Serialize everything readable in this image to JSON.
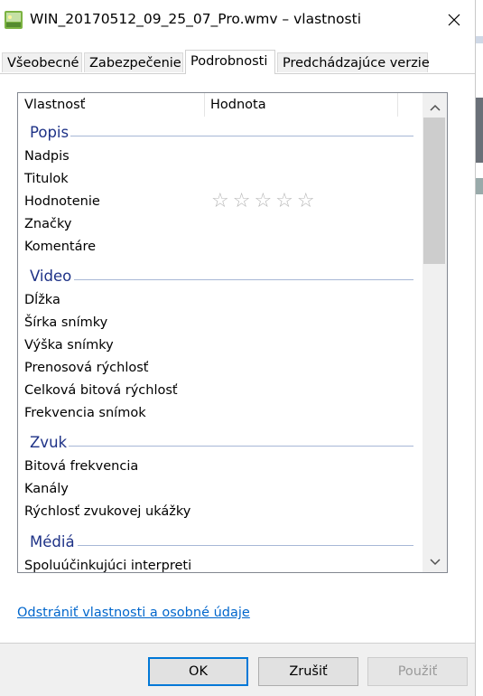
{
  "window": {
    "title": "WIN_20170512_09_25_07_Pro.wmv – vlastnosti",
    "close_icon": "close-icon"
  },
  "tabs": [
    {
      "label": "Všeobecné",
      "active": false
    },
    {
      "label": "Zabezpečenie",
      "active": false
    },
    {
      "label": "Podrobnosti",
      "active": true
    },
    {
      "label": "Predchádzajúce verzie",
      "active": false
    }
  ],
  "listview": {
    "columns": [
      "Vlastnosť",
      "Hodnota"
    ],
    "groups": {
      "popis": {
        "label": "Popis",
        "items": [
          "Nadpis",
          "Titulok",
          "Hodnotenie",
          "Značky",
          "Komentáre"
        ]
      },
      "video": {
        "label": "Video",
        "items": [
          "Dĺžka",
          "Šírka snímky",
          "Výška snímky",
          "Prenosová rýchlosť",
          "Celková bitová rýchlosť",
          "Frekvencia snímok"
        ]
      },
      "zvuk": {
        "label": "Zvuk",
        "items": [
          "Bitová frekvencia",
          "Kanály",
          "Rýchlosť zvukovej ukážky"
        ]
      },
      "media": {
        "label": "Médiá",
        "items": [
          "Spoluúčinkujúci interpreti"
        ]
      }
    },
    "rating": {
      "stars_filled": 0,
      "stars_total": 5,
      "glyphs": "☆☆☆☆☆"
    },
    "scroll_position": 0
  },
  "links": {
    "remove_properties": "Odstrániť vlastnosti a osobné údaje"
  },
  "buttons": {
    "ok": "OK",
    "cancel": "Zrušiť",
    "apply": "Použiť"
  },
  "colors": {
    "group_header": "#1e3287",
    "link": "#0066cc",
    "default_button_border": "#0078d7"
  }
}
